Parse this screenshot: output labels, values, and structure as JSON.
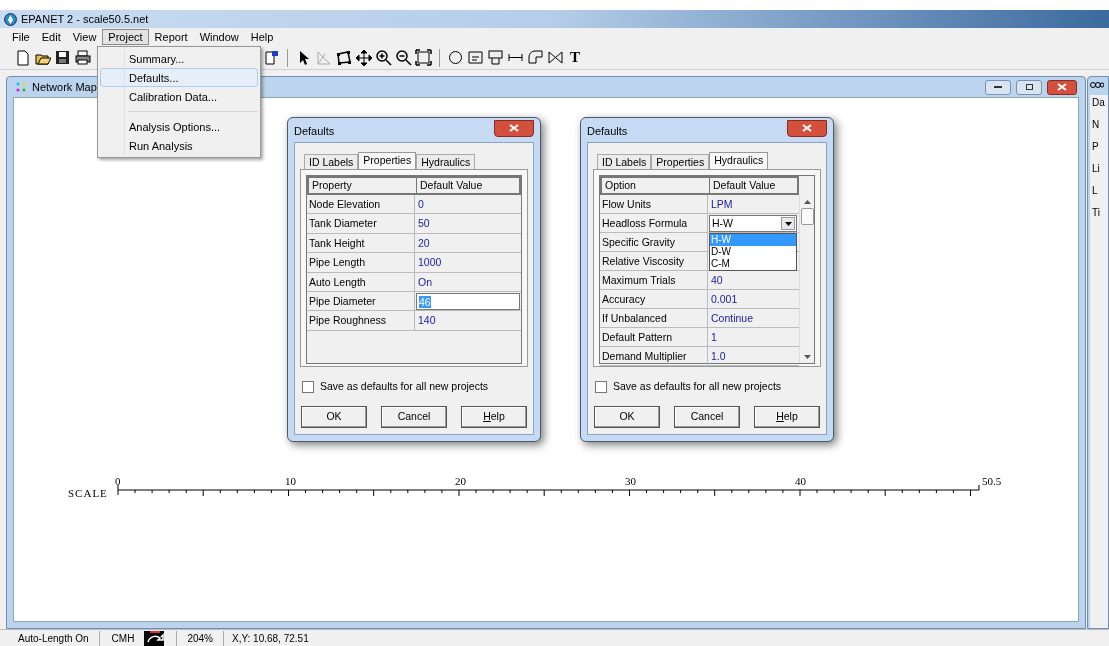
{
  "window": {
    "title": "EPANET 2 - scale50.5.net"
  },
  "menu": [
    {
      "label": "File",
      "selected": false
    },
    {
      "label": "Edit",
      "selected": false
    },
    {
      "label": "View",
      "selected": false
    },
    {
      "label": "Project",
      "selected": true
    },
    {
      "label": "Report",
      "selected": false
    },
    {
      "label": "Window",
      "selected": false
    },
    {
      "label": "Help",
      "selected": false
    }
  ],
  "project_menu": [
    {
      "kind": "item",
      "label": "Summary...",
      "selected": false
    },
    {
      "kind": "item",
      "label": "Defaults...",
      "selected": true
    },
    {
      "kind": "item",
      "label": "Calibration Data...",
      "selected": false
    },
    {
      "kind": "separator"
    },
    {
      "kind": "item",
      "label": "Analysis Options...",
      "selected": false
    },
    {
      "kind": "item",
      "label": "Run Analysis",
      "selected": false
    }
  ],
  "toolbar": {
    "text_tool": "T"
  },
  "network_map": {
    "title": "Network Map",
    "scale": {
      "label": "SCALE",
      "ticks": [
        "0",
        "10",
        "20",
        "30",
        "40",
        "50.5"
      ]
    }
  },
  "dialogs": [
    {
      "title": "Defaults",
      "scrollbar": false,
      "tabs": [
        {
          "label": "ID Labels",
          "selected": false
        },
        {
          "label": "Properties",
          "selected": true
        },
        {
          "label": "Hydraulics",
          "selected": false
        }
      ],
      "columns": [
        "Property",
        "Default Value"
      ],
      "rows": [
        {
          "kind": "text",
          "name": "Node Elevation",
          "value": "0"
        },
        {
          "kind": "text",
          "name": "Tank Diameter",
          "value": "50"
        },
        {
          "kind": "text",
          "name": "Tank Height",
          "value": "20"
        },
        {
          "kind": "text",
          "name": "Pipe Length",
          "value": "1000"
        },
        {
          "kind": "text",
          "name": "Auto Length",
          "value": "On"
        },
        {
          "kind": "edit",
          "name": "Pipe Diameter",
          "value": "46"
        },
        {
          "kind": "text",
          "name": "Pipe Roughness",
          "value": "140"
        }
      ],
      "save_checkbox": {
        "label": "Save as defaults for all new projects",
        "checked": false
      },
      "buttons": [
        "OK",
        "Cancel",
        "Help"
      ]
    },
    {
      "title": "Defaults",
      "scrollbar": true,
      "tabs": [
        {
          "label": "ID Labels",
          "selected": false
        },
        {
          "label": "Properties",
          "selected": false
        },
        {
          "label": "Hydraulics",
          "selected": true
        }
      ],
      "columns": [
        "Option",
        "Default Value"
      ],
      "rows": [
        {
          "kind": "text",
          "name": "Flow Units",
          "value": "LPM"
        },
        {
          "kind": "combo",
          "name": "Headloss Formula",
          "value": "H-W",
          "options": [
            {
              "label": "H-W",
              "selected": true
            },
            {
              "label": "D-W",
              "selected": false
            },
            {
              "label": "C-M",
              "selected": false
            }
          ]
        },
        {
          "kind": "covered",
          "name": "Specific Gravity"
        },
        {
          "kind": "covered",
          "name": "Relative Viscosity"
        },
        {
          "kind": "text",
          "name": "Maximum Trials",
          "value": "40"
        },
        {
          "kind": "text",
          "name": "Accuracy",
          "value": "0.001"
        },
        {
          "kind": "text",
          "name": "If Unbalanced",
          "value": "Continue"
        },
        {
          "kind": "text",
          "name": "Default Pattern",
          "value": "1"
        },
        {
          "kind": "text",
          "name": "Demand Multiplier",
          "value": "1.0"
        }
      ],
      "save_checkbox": {
        "label": "Save as defaults for all new projects",
        "checked": false
      },
      "buttons": [
        "OK",
        "Cancel",
        "Help"
      ]
    }
  ],
  "side_panel": {
    "texts": [
      "Da",
      "N",
      "P",
      "Li",
      "L",
      "Ti"
    ]
  },
  "status_bar": {
    "auto_length": "Auto-Length On",
    "flow_units": "CMH",
    "zoom": "204%",
    "coordinates": "X,Y: 10.68, 72.51"
  }
}
